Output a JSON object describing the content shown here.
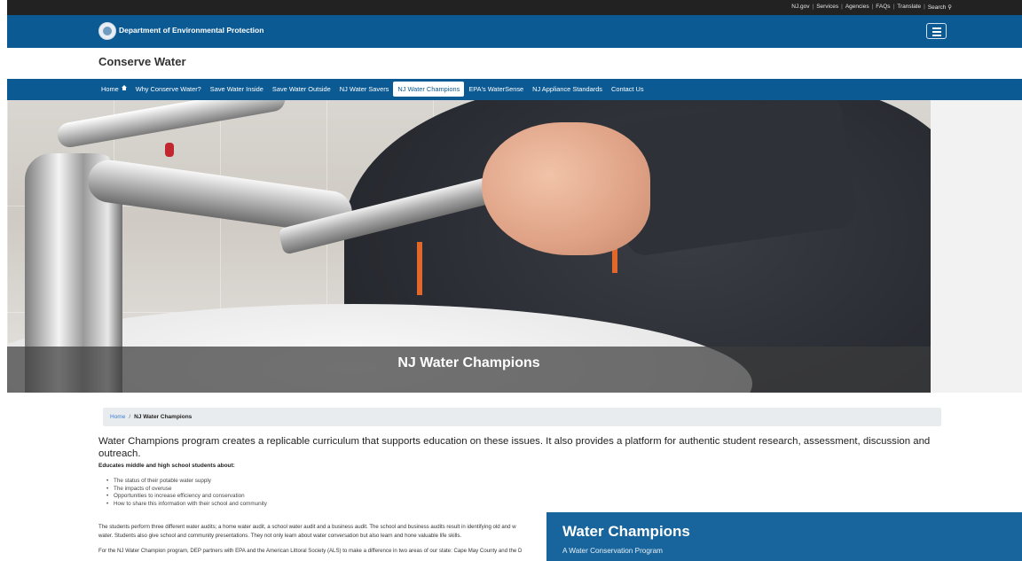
{
  "utility": {
    "links": [
      "NJ.gov",
      "Services",
      "Agencies",
      "FAQs",
      "Translate",
      "Search"
    ]
  },
  "header": {
    "department": "Department of Environmental Protection"
  },
  "site": {
    "title": "Conserve Water"
  },
  "nav": {
    "items": [
      {
        "label": "Home"
      },
      {
        "label": "Why Conserve Water?"
      },
      {
        "label": "Save Water Inside"
      },
      {
        "label": "Save Water Outside"
      },
      {
        "label": "NJ Water Savers"
      },
      {
        "label": "NJ Water Champions"
      },
      {
        "label": "EPA's WaterSense"
      },
      {
        "label": "NJ Appliance Standards"
      },
      {
        "label": "Contact Us"
      }
    ],
    "active_index": 5
  },
  "hero": {
    "caption": "NJ Water Champions"
  },
  "breadcrumb": {
    "home": "Home",
    "separator": "/",
    "current": "NJ Water Champions"
  },
  "content": {
    "lead": "Water Champions program creates a replicable curriculum that supports education on these issues. It also provides a platform for authentic student research, assessment, discussion and outreach.",
    "subhead": "Educates middle and high school students about:",
    "bullets": [
      "The status of their potable water supply",
      "The impacts of overuse",
      "Opportunities to increase efficiency and conservation",
      "How to share this information with their school and community"
    ],
    "para1_line1": "The students perform three different water audits; a home water audit, a school water audit and a business audit. The school and business audits result in identifying old and w",
    "para1_line2": "water. Students also give school and community presentations. They not only learn about water conversation but also learn and hone valuable life skills.",
    "para2": "For the NJ Water Champion program, DEP partners with EPA and the American Littoral Society (ALS) to make a difference in two areas of our state: Cape May County and the D"
  },
  "promo": {
    "title": "Water Champions",
    "subtitle": "A Water Conservation Program"
  },
  "colors": {
    "brand_blue": "#0b5a93",
    "promo_blue": "#17659c",
    "utility_black": "#222222"
  }
}
